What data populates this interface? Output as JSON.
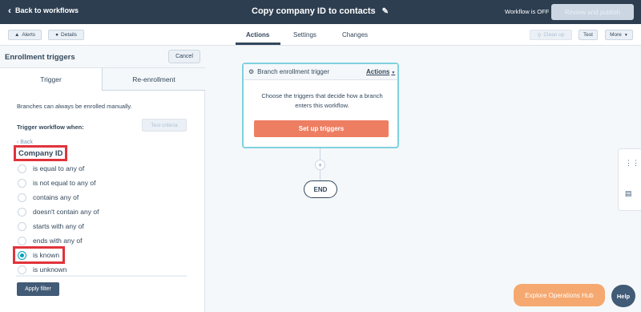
{
  "topbar": {
    "back_label": "Back to workflows",
    "workflow_title": "Copy company ID to contacts",
    "status": "Workflow is OFF",
    "review_button": "Review and publish"
  },
  "subbar": {
    "alerts_label": "Alerts",
    "details_label": "Details",
    "tabs": [
      "Actions",
      "Settings",
      "Changes"
    ],
    "active_tab": "Actions",
    "cleanup_label": "Clean up",
    "test_label": "Test",
    "more_label": "More"
  },
  "panel": {
    "title": "Enrollment triggers",
    "cancel_label": "Cancel",
    "tabs": [
      "Trigger",
      "Re-enrollment"
    ],
    "hint": "Branches can always be enrolled manually.",
    "trigger_when": "Trigger workflow when:",
    "test_criteria": "Test criteria",
    "back_label": "Back",
    "property_name": "Company ID",
    "options": [
      "is equal to any of",
      "is not equal to any of",
      "contains any of",
      "doesn't contain any of",
      "starts with any of",
      "ends with any of",
      "is known",
      "is unknown"
    ],
    "selected_option": "is known",
    "apply_label": "Apply filter"
  },
  "canvas": {
    "card_title": "Branch enrollment trigger",
    "card_actions": "Actions",
    "card_desc": "Choose the triggers that decide how a branch enters this workflow.",
    "setup_button": "Set up triggers",
    "end_label": "END"
  },
  "widgets": {
    "explore_label": "Explore Operations Hub",
    "help_label": "Help"
  },
  "colors": {
    "topbar": "#2d3e50",
    "accent_orange": "#ee7e62",
    "highlight_red": "#e0333b",
    "teal": "#00a4bd"
  }
}
